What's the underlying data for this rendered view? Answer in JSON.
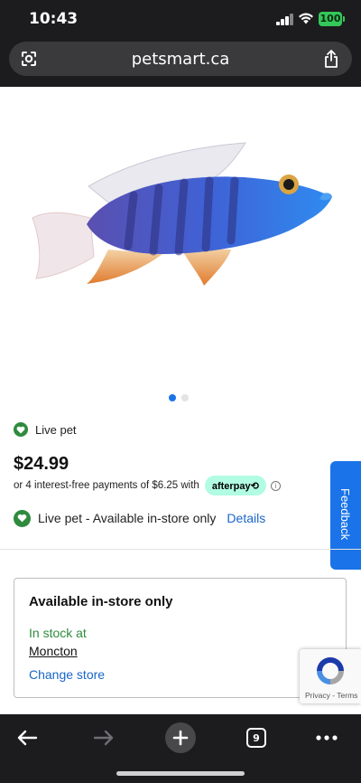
{
  "status_bar": {
    "time": "10:43",
    "battery": "100"
  },
  "browser": {
    "url": "petsmart.ca",
    "tab_count": "9"
  },
  "product": {
    "image_icon": "fish-photo",
    "carousel": {
      "current": 1,
      "total": 2
    },
    "live_pet_label": "Live pet",
    "price": "$24.99",
    "afterpay_text": "or 4 interest-free payments of $6.25 with",
    "afterpay_badge": "afterpay⟲",
    "info_icon": "ⓘ",
    "availability_text": "Live pet - Available in-store only",
    "details_link": "Details"
  },
  "feedback_tab": "Feedback",
  "store": {
    "title": "Available in-store only",
    "stock_status": "In stock at",
    "store_name": "Moncton",
    "change_store": "Change store"
  },
  "recaptcha": {
    "links": "Privacy - Terms"
  },
  "colors": {
    "accent_blue": "#1a73e8",
    "instock_green": "#2e8b3d",
    "afterpay_mint": "#b2fce4"
  }
}
